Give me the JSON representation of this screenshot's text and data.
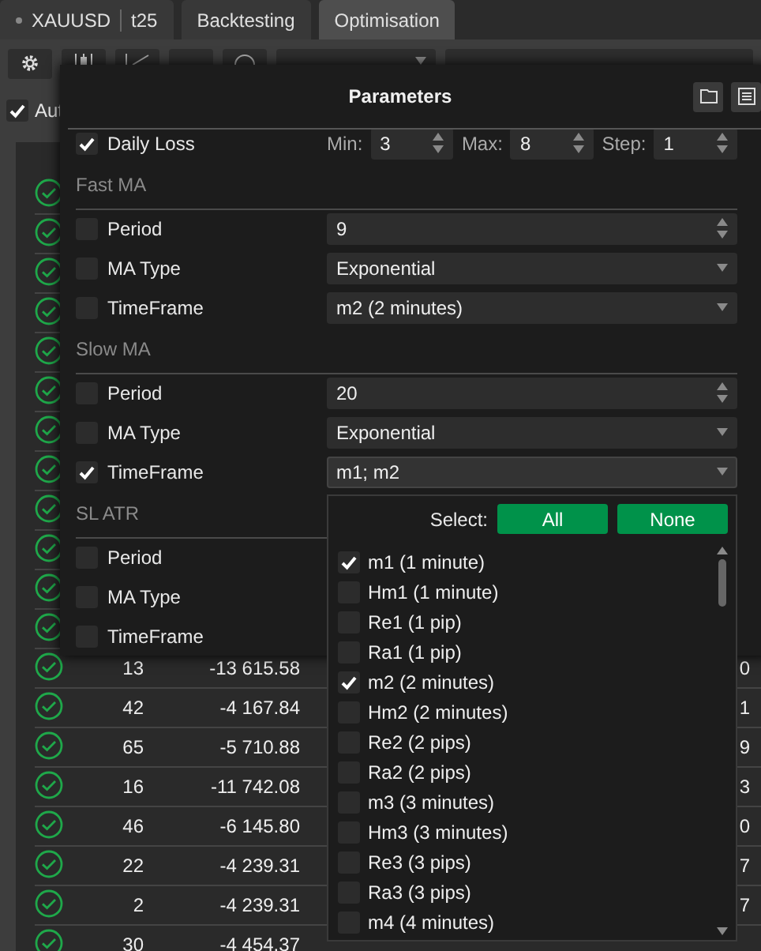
{
  "tabs": [
    {
      "kind": "symbol",
      "label": "XAUUSD",
      "suffix": "t25",
      "selected": false
    },
    {
      "kind": "plain",
      "label": "Backtesting",
      "selected": false
    },
    {
      "kind": "plain",
      "label": "Optimisation",
      "selected": true
    }
  ],
  "auto_checkbox": {
    "label": "Aut",
    "checked": true
  },
  "results": {
    "rows": [
      {
        "passed": true
      },
      {
        "passed": true
      },
      {
        "passed": true
      },
      {
        "passed": true
      },
      {
        "passed": true
      },
      {
        "passed": true
      },
      {
        "passed": true
      },
      {
        "passed": true
      },
      {
        "passed": true
      },
      {
        "passed": true
      },
      {
        "passed": true
      },
      {
        "passed": true
      },
      {
        "passed": true,
        "column_2": "13",
        "column_3": "-13 615.58",
        "column_4": "0"
      },
      {
        "passed": true,
        "column_2": "42",
        "column_3": "-4 167.84",
        "column_4": "1"
      },
      {
        "passed": true,
        "column_2": "65",
        "column_3": "-5 710.88",
        "column_4": "9"
      },
      {
        "passed": true,
        "column_2": "16",
        "column_3": "-11 742.08",
        "column_4": "3"
      },
      {
        "passed": true,
        "column_2": "46",
        "column_3": "-6 145.80",
        "column_4": "0"
      },
      {
        "passed": true,
        "column_2": "22",
        "column_3": "-4 239.31",
        "column_4": "7"
      },
      {
        "passed": true,
        "column_2": "2",
        "column_3": "-4 239.31",
        "column_4": "7"
      },
      {
        "passed": true,
        "column_2": "30",
        "column_3": "-4 454.37"
      }
    ]
  },
  "dialog": {
    "title": "Parameters",
    "daily_loss": {
      "label": "Daily Loss",
      "checked": true,
      "min_label": "Min:",
      "min": "3",
      "max_label": "Max:",
      "max": "8",
      "step_label": "Step:",
      "step": "1"
    },
    "sections": [
      {
        "title": "Fast MA",
        "params": [
          {
            "label": "Period",
            "checked": false,
            "kind": "spin",
            "value": "9"
          },
          {
            "label": "MA Type",
            "checked": false,
            "kind": "select",
            "value": "Exponential",
            "expanded": false
          },
          {
            "label": "TimeFrame",
            "checked": false,
            "kind": "select",
            "value": "m2 (2 minutes)",
            "expanded": false
          }
        ]
      },
      {
        "title": "Slow MA",
        "params": [
          {
            "label": "Period",
            "checked": false,
            "kind": "spin",
            "value": "20"
          },
          {
            "label": "MA Type",
            "checked": false,
            "kind": "select",
            "value": "Exponential",
            "expanded": false
          },
          {
            "label": "TimeFrame",
            "checked": true,
            "kind": "select",
            "value": "m1; m2",
            "expanded": true
          }
        ]
      },
      {
        "title": "SL ATR",
        "params": [
          {
            "label": "Period",
            "checked": false,
            "kind": "covered"
          },
          {
            "label": "MA Type",
            "checked": false,
            "kind": "covered"
          },
          {
            "label": "TimeFrame",
            "checked": false,
            "kind": "covered"
          }
        ]
      }
    ]
  },
  "dropdown": {
    "select_label": "Select:",
    "buttons": [
      "All",
      "None"
    ],
    "options": [
      {
        "label": "m1 (1 minute)",
        "checked": true
      },
      {
        "label": "Hm1 (1 minute)",
        "checked": false
      },
      {
        "label": "Re1 (1 pip)",
        "checked": false
      },
      {
        "label": "Ra1 (1 pip)",
        "checked": false
      },
      {
        "label": "m2 (2 minutes)",
        "checked": true
      },
      {
        "label": "Hm2 (2 minutes)",
        "checked": false
      },
      {
        "label": "Re2 (2 pips)",
        "checked": false
      },
      {
        "label": "Ra2 (2 pips)",
        "checked": false
      },
      {
        "label": "m3 (3 minutes)",
        "checked": false
      },
      {
        "label": "Hm3 (3 minutes)",
        "checked": false
      },
      {
        "label": "Re3 (3 pips)",
        "checked": false
      },
      {
        "label": "Ra3 (3 pips)",
        "checked": false
      },
      {
        "label": "m4 (4 minutes)",
        "checked": false
      }
    ]
  }
}
